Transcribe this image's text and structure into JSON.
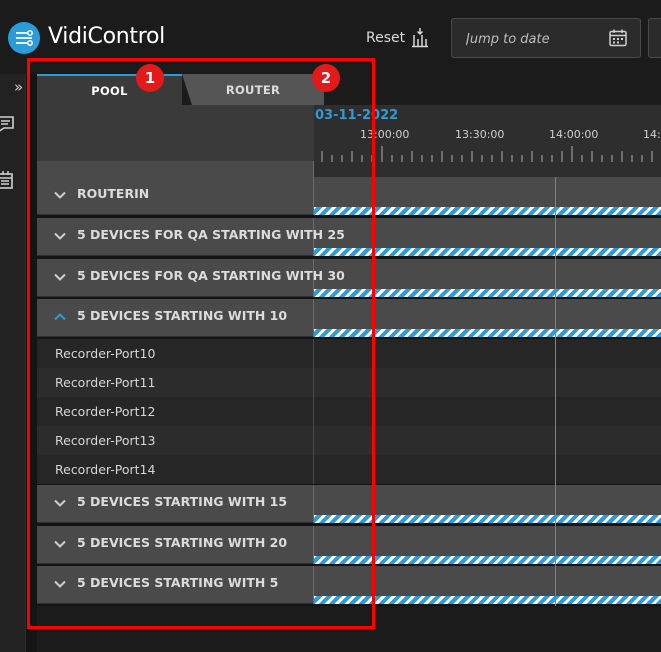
{
  "app": {
    "title": "VidiControl"
  },
  "header": {
    "reset_label": "Reset",
    "jump_placeholder": "Jump to date"
  },
  "tabs": [
    {
      "label": "POOL",
      "active": true
    },
    {
      "label": "ROUTER",
      "active": false
    }
  ],
  "timeline": {
    "date": "03-11-2022",
    "times": [
      "13:00:00",
      "13:30:00",
      "14:00:00",
      "14:3"
    ]
  },
  "groups": [
    {
      "label": "ROUTERIN",
      "expanded": false
    },
    {
      "label": "5 DEVICES FOR QA STARTING WITH 25",
      "expanded": false
    },
    {
      "label": "5 DEVICES FOR QA STARTING WITH 30",
      "expanded": false
    },
    {
      "label": "5 DEVICES STARTING WITH 10",
      "expanded": true
    },
    {
      "label": "5 DEVICES STARTING WITH 15",
      "expanded": false
    },
    {
      "label": "5 DEVICES STARTING WITH 20",
      "expanded": false
    },
    {
      "label": "5 DEVICES STARTING WITH 5",
      "expanded": false
    }
  ],
  "devices": [
    {
      "label": "Recorder-Port10"
    },
    {
      "label": "Recorder-Port11"
    },
    {
      "label": "Recorder-Port12"
    },
    {
      "label": "Recorder-Port13"
    },
    {
      "label": "Recorder-Port14"
    }
  ],
  "annotations": {
    "badge1": "1",
    "badge2": "2"
  },
  "colors": {
    "accent": "#2b9bd9",
    "annotation": "#ff0000"
  }
}
